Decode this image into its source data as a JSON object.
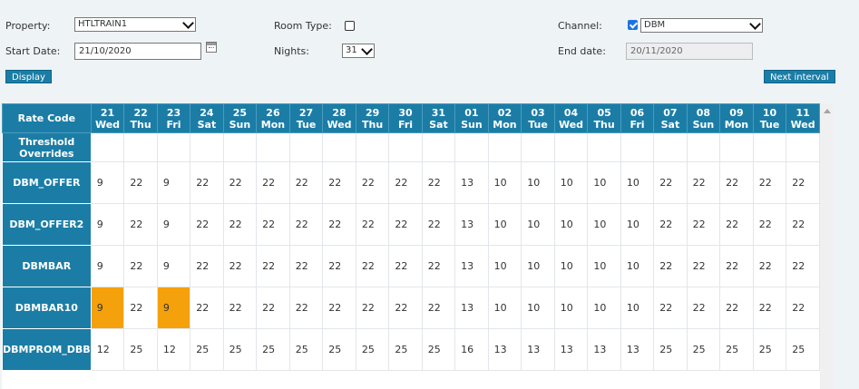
{
  "filters": {
    "property_label": "Property:",
    "property_value": "HTLTRAIN1",
    "room_type_label": "Room Type:",
    "room_type_checked": false,
    "channel_label": "Channel:",
    "channel_checked": true,
    "channel_value": "DBM",
    "start_date_label": "Start Date:",
    "start_date_value": "21/10/2020",
    "nights_label": "Nights:",
    "nights_value": "31",
    "end_date_label": "End date:",
    "end_date_value": "20/11/2020"
  },
  "buttons": {
    "display": "Display",
    "next_interval": "Next interval"
  },
  "grid": {
    "corner_header": "Rate Code",
    "columns": [
      {
        "day": "21",
        "dow": "Wed"
      },
      {
        "day": "22",
        "dow": "Thu"
      },
      {
        "day": "23",
        "dow": "Fri"
      },
      {
        "day": "24",
        "dow": "Sat"
      },
      {
        "day": "25",
        "dow": "Sun"
      },
      {
        "day": "26",
        "dow": "Mon"
      },
      {
        "day": "27",
        "dow": "Tue"
      },
      {
        "day": "28",
        "dow": "Wed"
      },
      {
        "day": "29",
        "dow": "Thu"
      },
      {
        "day": "30",
        "dow": "Fri"
      },
      {
        "day": "31",
        "dow": "Sat"
      },
      {
        "day": "01",
        "dow": "Sun"
      },
      {
        "day": "02",
        "dow": "Mon"
      },
      {
        "day": "03",
        "dow": "Tue"
      },
      {
        "day": "04",
        "dow": "Wed"
      },
      {
        "day": "05",
        "dow": "Thu"
      },
      {
        "day": "06",
        "dow": "Fri"
      },
      {
        "day": "07",
        "dow": "Sat"
      },
      {
        "day": "08",
        "dow": "Sun"
      },
      {
        "day": "09",
        "dow": "Mon"
      },
      {
        "day": "10",
        "dow": "Tue"
      },
      {
        "day": "11",
        "dow": "Wed"
      }
    ],
    "threshold_label": "Threshold Overrides",
    "rows": [
      {
        "code": "DBM_OFFER",
        "values": [
          "9",
          "22",
          "9",
          "22",
          "22",
          "22",
          "22",
          "22",
          "22",
          "22",
          "22",
          "13",
          "10",
          "10",
          "10",
          "10",
          "10",
          "22",
          "22",
          "22",
          "22",
          "22"
        ],
        "highlight": []
      },
      {
        "code": "DBM_OFFER2",
        "values": [
          "9",
          "22",
          "9",
          "22",
          "22",
          "22",
          "22",
          "22",
          "22",
          "22",
          "22",
          "13",
          "10",
          "10",
          "10",
          "10",
          "10",
          "22",
          "22",
          "22",
          "22",
          "22"
        ],
        "highlight": []
      },
      {
        "code": "DBMBAR",
        "values": [
          "9",
          "22",
          "9",
          "22",
          "22",
          "22",
          "22",
          "22",
          "22",
          "22",
          "22",
          "13",
          "10",
          "10",
          "10",
          "10",
          "10",
          "22",
          "22",
          "22",
          "22",
          "22"
        ],
        "highlight": []
      },
      {
        "code": "DBMBAR10",
        "values": [
          "9",
          "22",
          "9",
          "22",
          "22",
          "22",
          "22",
          "22",
          "22",
          "22",
          "22",
          "13",
          "10",
          "10",
          "10",
          "10",
          "10",
          "22",
          "22",
          "22",
          "22",
          "22"
        ],
        "highlight": [
          0,
          2
        ]
      },
      {
        "code": "DBMPROM_DBB",
        "values": [
          "12",
          "25",
          "12",
          "25",
          "25",
          "25",
          "25",
          "25",
          "25",
          "25",
          "25",
          "16",
          "13",
          "13",
          "13",
          "13",
          "13",
          "25",
          "25",
          "25",
          "25",
          "25"
        ],
        "highlight": []
      }
    ]
  },
  "colors": {
    "header_bg": "#1b7da6",
    "highlight": "#f5a10c",
    "page_bg": "#eef3f6"
  },
  "icons": {
    "calendar": "calendar-icon",
    "dropdown": "chevron-down-icon",
    "scroll_up": "scroll-up-arrow-icon"
  }
}
